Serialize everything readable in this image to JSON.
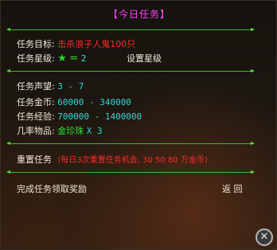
{
  "title": "【今日任务】",
  "target": {
    "label": "任务目标:",
    "value": "击杀浪子人鬼100只"
  },
  "level": {
    "label": "任务星级:",
    "star_icon": "star-icon",
    "equals": "=",
    "value": "2",
    "set_button": "设置星级"
  },
  "reputation": {
    "label": "任务声望:",
    "value": "3 - 7"
  },
  "gold": {
    "label": "任务金币:",
    "value": "60000 - 340000"
  },
  "exp": {
    "label": "任务经验:",
    "value": "700000 - 1400000"
  },
  "item": {
    "label": "几率物品:",
    "name": "金珍珠",
    "count": "X 3"
  },
  "reset": {
    "button": "重置任务",
    "note": "(每日3次重置任务机会, 30 50 80 万金币)"
  },
  "claim_button": "完成任务领取奖励",
  "back_button": "返 回",
  "colors": {
    "title": "#ff44ff",
    "divider": "#3fb82a",
    "target": "#ff2a2a",
    "value": "#30d7d7",
    "item": "#30e030"
  }
}
